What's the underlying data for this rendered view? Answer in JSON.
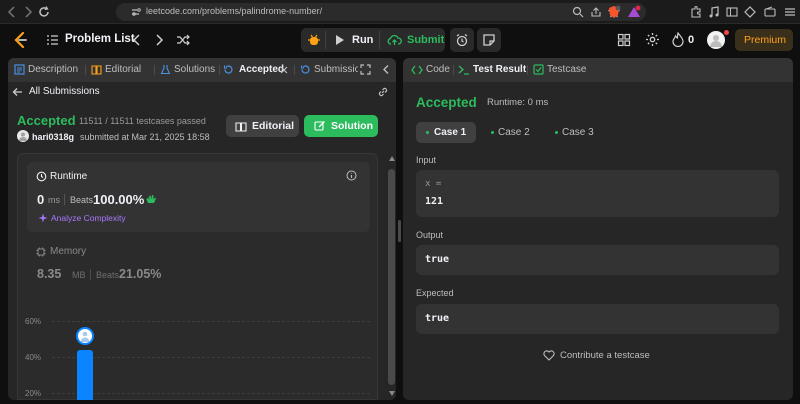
{
  "browser": {
    "url": "leetcode.com/problems/palindrome-number/"
  },
  "header": {
    "problem_list_label": "Problem List",
    "run_label": "Run",
    "submit_label": "Submit",
    "streak_count": "0",
    "premium_label": "Premium"
  },
  "left_panel": {
    "tabs": [
      {
        "label": "Description"
      },
      {
        "label": "Editorial"
      },
      {
        "label": "Solutions"
      },
      {
        "label": "Accepted"
      },
      {
        "label": "Submissio"
      }
    ],
    "all_submissions_label": "All Submissions",
    "status": "Accepted",
    "testcases_passed": "11511 / 11511 testcases passed",
    "username": "hari0318g",
    "submitted_at": "submitted at Mar 21, 2025 18:58",
    "editorial_button": "Editorial",
    "solution_button": "Solution",
    "runtime": {
      "title": "Runtime",
      "value": "0",
      "unit": "ms",
      "beats_label": "Beats",
      "beats_value": "100.00%",
      "analyze_label": "Analyze Complexity"
    },
    "memory": {
      "title": "Memory",
      "value": "8.35",
      "unit": "MB",
      "beats_label": "Beats",
      "beats_value": "21.05%"
    },
    "chart_data": {
      "type": "bar",
      "y_ticks": [
        "60%",
        "40%",
        "20%"
      ],
      "user_bar_value": 44
    }
  },
  "right_panel": {
    "tabs": [
      {
        "label": "Code"
      },
      {
        "label": "Test Result"
      },
      {
        "label": "Testcase"
      }
    ],
    "status": "Accepted",
    "runtime_text": "Runtime: 0 ms",
    "cases": [
      {
        "label": "Case 1"
      },
      {
        "label": "Case 2"
      },
      {
        "label": "Case 3"
      }
    ],
    "input_label": "Input",
    "input_var": "x =",
    "input_value": "121",
    "output_label": "Output",
    "output_value": "true",
    "expected_label": "Expected",
    "expected_value": "true",
    "contribute_label": "Contribute a testcase"
  },
  "colors": {
    "accent_green": "#2cbb5d",
    "premium_orange": "#ffa116",
    "bar_blue": "#0a84ff"
  }
}
